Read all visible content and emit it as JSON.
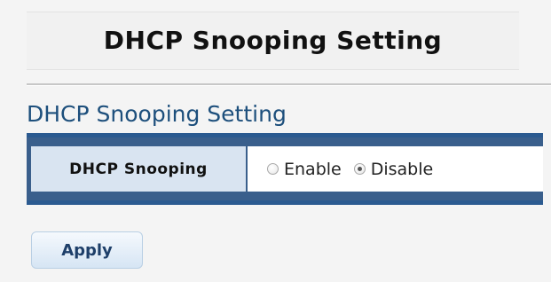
{
  "page": {
    "title": "DHCP Snooping Setting"
  },
  "section": {
    "title": "DHCP Snooping Setting"
  },
  "setting": {
    "label": "DHCP Snooping",
    "options": [
      {
        "label": "Enable",
        "selected": false
      },
      {
        "label": "Disable",
        "selected": true
      }
    ]
  },
  "actions": {
    "apply_label": "Apply"
  },
  "colors": {
    "accent": "#2b5a90",
    "section_title": "#1d4f7c",
    "label_background": "#d9e4f1"
  }
}
